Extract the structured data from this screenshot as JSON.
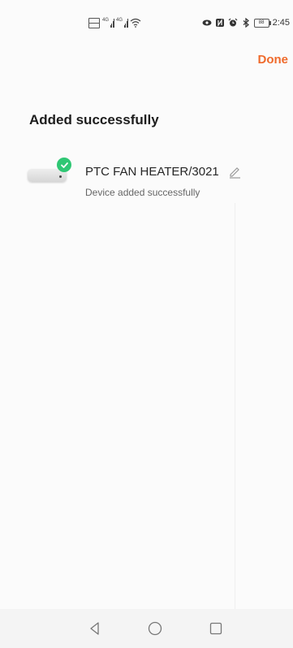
{
  "status_bar": {
    "signal_label_1": "4G",
    "signal_label_2": "4G",
    "battery": "88",
    "time": "2:45"
  },
  "header": {
    "done_label": "Done"
  },
  "main": {
    "title": "Added successfully",
    "device": {
      "name": "PTC FAN HEATER/3021",
      "status": "Device added successfully"
    }
  },
  "colors": {
    "accent": "#ef6a2b",
    "success": "#2fc774"
  },
  "icons": [
    "hd-icon",
    "signal-icon",
    "wifi-icon",
    "eye-icon",
    "nfc-icon",
    "alarm-icon",
    "bluetooth-icon",
    "battery-icon",
    "check-icon",
    "edit-icon",
    "back-icon",
    "home-icon",
    "recents-icon"
  ]
}
